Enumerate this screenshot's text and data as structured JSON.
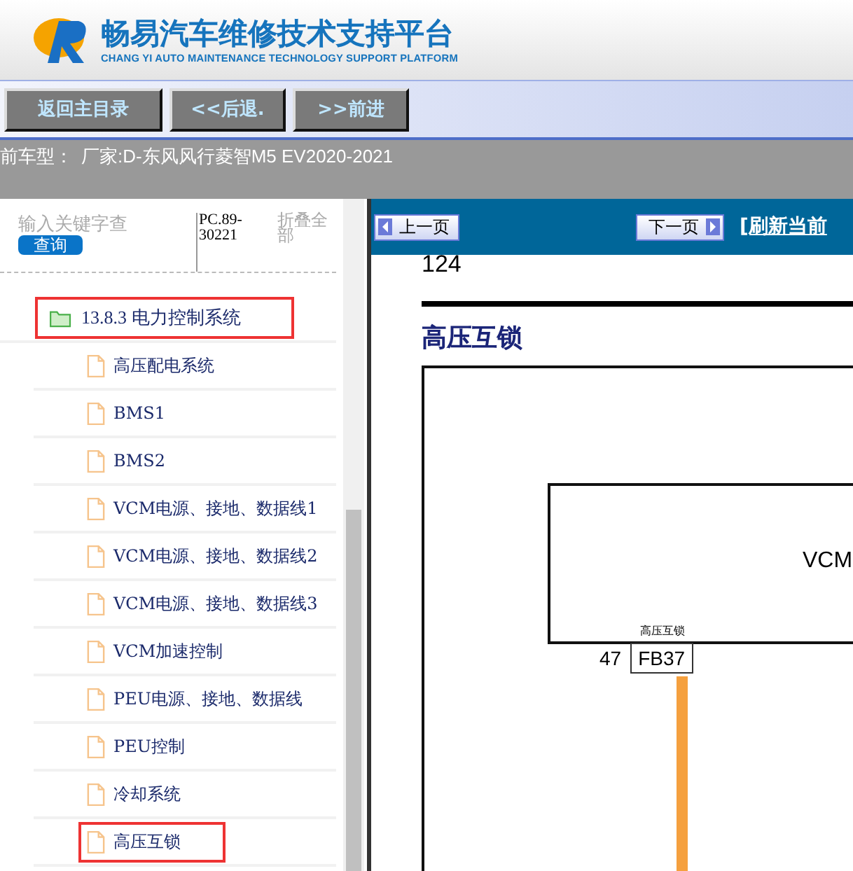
{
  "header": {
    "title": "畅易汽车维修技术支持平台",
    "subtitle": "CHANG YI AUTO MAINTENANCE TECHNOLOGY SUPPORT PLATFORM"
  },
  "nav_buttons": [
    "返回主目录",
    "<<后退.",
    ">>前进"
  ],
  "vehicle_bar": {
    "label": "前车型：",
    "value": "厂家:D-东风风行菱智M5 EV2020-2021"
  },
  "sidebar": {
    "search": {
      "placeholder": "输入关键字查"
    },
    "search_button": "查询",
    "code": "PC.89-30221",
    "collapse_all": "折叠全部",
    "tree": [
      {
        "label": "13.8.3 电力控制系统",
        "kind": "folder",
        "highlighted": true,
        "children": [
          {
            "label": "高压配电系统",
            "kind": "page",
            "highlighted": false
          },
          {
            "label": "BMS1",
            "kind": "page",
            "highlighted": false
          },
          {
            "label": "BMS2",
            "kind": "page",
            "highlighted": false
          },
          {
            "label": "VCM电源、接地、数据线1",
            "kind": "page",
            "highlighted": false
          },
          {
            "label": "VCM电源、接地、数据线2",
            "kind": "page",
            "highlighted": false
          },
          {
            "label": "VCM电源、接地、数据线3",
            "kind": "page",
            "highlighted": false
          },
          {
            "label": "VCM加速控制",
            "kind": "page",
            "highlighted": false
          },
          {
            "label": "PEU电源、接地、数据线",
            "kind": "page",
            "highlighted": false
          },
          {
            "label": "PEU控制",
            "kind": "page",
            "highlighted": false
          },
          {
            "label": "冷却系统",
            "kind": "page",
            "highlighted": false
          },
          {
            "label": "高压互锁",
            "kind": "page",
            "highlighted": true
          }
        ]
      }
    ]
  },
  "viewer": {
    "prev_button": "上一页",
    "next_button": "下一页",
    "refresh_link": "[刷新当前",
    "page_number": "124",
    "title": "高压互锁",
    "diagram": {
      "module": "VCM",
      "signal": "高压互锁",
      "pin": "47",
      "connector": "FB37"
    }
  }
}
